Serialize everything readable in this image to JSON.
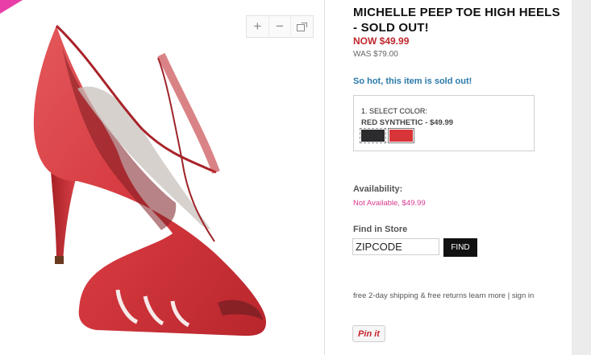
{
  "product": {
    "title": "MICHELLE PEEP TOE HIGH HEELS - SOLD OUT!",
    "price_now": "NOW $49.99",
    "price_was": "WAS $79.00",
    "sold_message": "So hot, this item is sold out!"
  },
  "image_controls": {
    "zoom_in": "+",
    "zoom_out": "−",
    "expand_icon": "expand-icon"
  },
  "color_select": {
    "step_label": "1. SELECT COLOR:",
    "selected": "RED SYNTHETIC - $49.99",
    "swatches": [
      {
        "name": "black",
        "color": "#2c2c2e"
      },
      {
        "name": "red",
        "color": "#d8353a"
      }
    ]
  },
  "availability": {
    "label": "Availability:",
    "value": "Not Available, $49.99"
  },
  "find_in_store": {
    "label": "Find in Store",
    "zip_value": "ZIPCODE",
    "button": "FIND"
  },
  "shipping": {
    "text": "free 2-day shipping & free returns",
    "learn_more": "learn more",
    "separator": "|",
    "sign_in": "sign in"
  },
  "pinit": {
    "label": "Pin it"
  },
  "colors": {
    "accent_pink": "#e83ea8",
    "price_red": "#c0282d",
    "link_blue": "#2a7aaa",
    "availability_pink": "#d93a8e"
  }
}
